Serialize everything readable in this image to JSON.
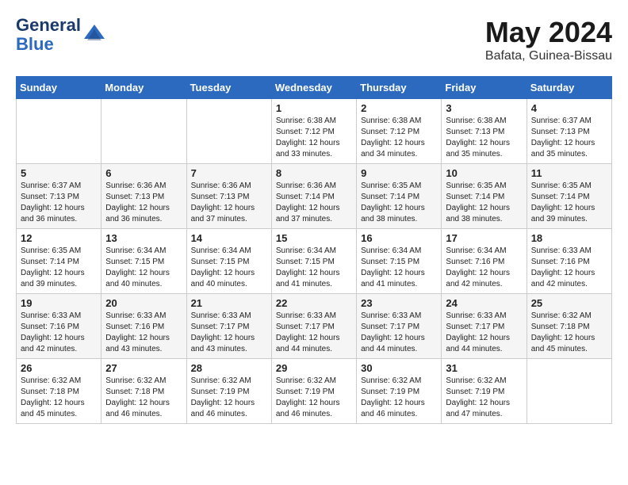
{
  "header": {
    "logo_line1": "General",
    "logo_line2": "Blue",
    "month": "May 2024",
    "location": "Bafata, Guinea-Bissau"
  },
  "weekdays": [
    "Sunday",
    "Monday",
    "Tuesday",
    "Wednesday",
    "Thursday",
    "Friday",
    "Saturday"
  ],
  "weeks": [
    [
      {
        "day": "",
        "info": ""
      },
      {
        "day": "",
        "info": ""
      },
      {
        "day": "",
        "info": ""
      },
      {
        "day": "1",
        "info": "Sunrise: 6:38 AM\nSunset: 7:12 PM\nDaylight: 12 hours\nand 33 minutes."
      },
      {
        "day": "2",
        "info": "Sunrise: 6:38 AM\nSunset: 7:12 PM\nDaylight: 12 hours\nand 34 minutes."
      },
      {
        "day": "3",
        "info": "Sunrise: 6:38 AM\nSunset: 7:13 PM\nDaylight: 12 hours\nand 35 minutes."
      },
      {
        "day": "4",
        "info": "Sunrise: 6:37 AM\nSunset: 7:13 PM\nDaylight: 12 hours\nand 35 minutes."
      }
    ],
    [
      {
        "day": "5",
        "info": "Sunrise: 6:37 AM\nSunset: 7:13 PM\nDaylight: 12 hours\nand 36 minutes."
      },
      {
        "day": "6",
        "info": "Sunrise: 6:36 AM\nSunset: 7:13 PM\nDaylight: 12 hours\nand 36 minutes."
      },
      {
        "day": "7",
        "info": "Sunrise: 6:36 AM\nSunset: 7:13 PM\nDaylight: 12 hours\nand 37 minutes."
      },
      {
        "day": "8",
        "info": "Sunrise: 6:36 AM\nSunset: 7:14 PM\nDaylight: 12 hours\nand 37 minutes."
      },
      {
        "day": "9",
        "info": "Sunrise: 6:35 AM\nSunset: 7:14 PM\nDaylight: 12 hours\nand 38 minutes."
      },
      {
        "day": "10",
        "info": "Sunrise: 6:35 AM\nSunset: 7:14 PM\nDaylight: 12 hours\nand 38 minutes."
      },
      {
        "day": "11",
        "info": "Sunrise: 6:35 AM\nSunset: 7:14 PM\nDaylight: 12 hours\nand 39 minutes."
      }
    ],
    [
      {
        "day": "12",
        "info": "Sunrise: 6:35 AM\nSunset: 7:14 PM\nDaylight: 12 hours\nand 39 minutes."
      },
      {
        "day": "13",
        "info": "Sunrise: 6:34 AM\nSunset: 7:15 PM\nDaylight: 12 hours\nand 40 minutes."
      },
      {
        "day": "14",
        "info": "Sunrise: 6:34 AM\nSunset: 7:15 PM\nDaylight: 12 hours\nand 40 minutes."
      },
      {
        "day": "15",
        "info": "Sunrise: 6:34 AM\nSunset: 7:15 PM\nDaylight: 12 hours\nand 41 minutes."
      },
      {
        "day": "16",
        "info": "Sunrise: 6:34 AM\nSunset: 7:15 PM\nDaylight: 12 hours\nand 41 minutes."
      },
      {
        "day": "17",
        "info": "Sunrise: 6:34 AM\nSunset: 7:16 PM\nDaylight: 12 hours\nand 42 minutes."
      },
      {
        "day": "18",
        "info": "Sunrise: 6:33 AM\nSunset: 7:16 PM\nDaylight: 12 hours\nand 42 minutes."
      }
    ],
    [
      {
        "day": "19",
        "info": "Sunrise: 6:33 AM\nSunset: 7:16 PM\nDaylight: 12 hours\nand 42 minutes."
      },
      {
        "day": "20",
        "info": "Sunrise: 6:33 AM\nSunset: 7:16 PM\nDaylight: 12 hours\nand 43 minutes."
      },
      {
        "day": "21",
        "info": "Sunrise: 6:33 AM\nSunset: 7:17 PM\nDaylight: 12 hours\nand 43 minutes."
      },
      {
        "day": "22",
        "info": "Sunrise: 6:33 AM\nSunset: 7:17 PM\nDaylight: 12 hours\nand 44 minutes."
      },
      {
        "day": "23",
        "info": "Sunrise: 6:33 AM\nSunset: 7:17 PM\nDaylight: 12 hours\nand 44 minutes."
      },
      {
        "day": "24",
        "info": "Sunrise: 6:33 AM\nSunset: 7:17 PM\nDaylight: 12 hours\nand 44 minutes."
      },
      {
        "day": "25",
        "info": "Sunrise: 6:32 AM\nSunset: 7:18 PM\nDaylight: 12 hours\nand 45 minutes."
      }
    ],
    [
      {
        "day": "26",
        "info": "Sunrise: 6:32 AM\nSunset: 7:18 PM\nDaylight: 12 hours\nand 45 minutes."
      },
      {
        "day": "27",
        "info": "Sunrise: 6:32 AM\nSunset: 7:18 PM\nDaylight: 12 hours\nand 46 minutes."
      },
      {
        "day": "28",
        "info": "Sunrise: 6:32 AM\nSunset: 7:19 PM\nDaylight: 12 hours\nand 46 minutes."
      },
      {
        "day": "29",
        "info": "Sunrise: 6:32 AM\nSunset: 7:19 PM\nDaylight: 12 hours\nand 46 minutes."
      },
      {
        "day": "30",
        "info": "Sunrise: 6:32 AM\nSunset: 7:19 PM\nDaylight: 12 hours\nand 46 minutes."
      },
      {
        "day": "31",
        "info": "Sunrise: 6:32 AM\nSunset: 7:19 PM\nDaylight: 12 hours\nand 47 minutes."
      },
      {
        "day": "",
        "info": ""
      }
    ]
  ]
}
